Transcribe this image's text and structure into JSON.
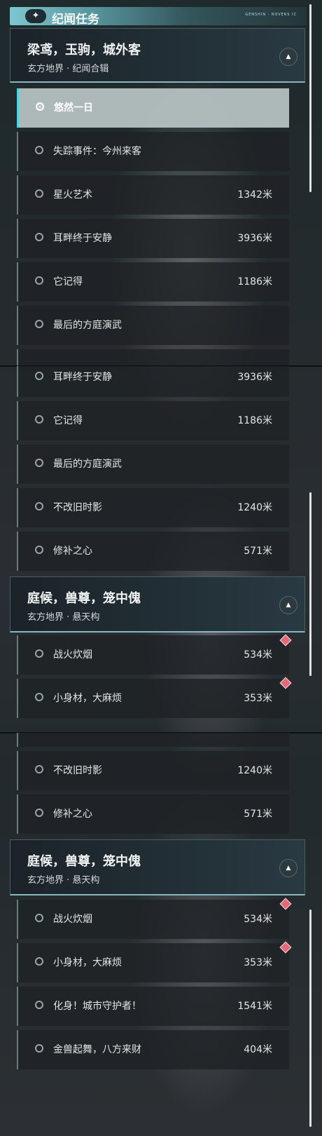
{
  "header": {
    "title": "纪闻任务",
    "star_icon": "✦",
    "tag": "GENSHIN · ROVERS IC"
  },
  "groups": {
    "g1": {
      "title": "梁鸢，玉驹，城外客",
      "subtitle": "玄方地界 · 纪闻合辑"
    },
    "g2": {
      "title": "庭候，兽尊，笼中傀",
      "subtitle": "玄方地界 · 悬天构"
    }
  },
  "quests": {
    "q0": {
      "label": "悠然一日",
      "dist": ""
    },
    "q1": {
      "label": "失踪事件：今州来客",
      "dist": ""
    },
    "q2": {
      "label": "星火艺术",
      "dist": "1342米"
    },
    "q3": {
      "label": "耳畔终于安静",
      "dist": "3936米"
    },
    "q4": {
      "label": "它记得",
      "dist": "1186米"
    },
    "q5": {
      "label": "最后的方庭演武",
      "dist": ""
    },
    "q6": {
      "label": "不改旧时影",
      "dist": "1240米"
    },
    "q7": {
      "label": "修补之心",
      "dist": "571米"
    },
    "q8": {
      "label": "战火炊烟",
      "dist": "534米"
    },
    "q9": {
      "label": "小身材，大麻烦",
      "dist": "353米"
    },
    "q10": {
      "label": "化身！城市守护者！",
      "dist": "1541米"
    },
    "q11": {
      "label": "金兽起舞，八方来财",
      "dist": "404米"
    }
  },
  "selected_quest": "悠然一日",
  "colors": {
    "accent": "#4fd3e0",
    "tracked_marker": "#e06a78",
    "header_bar": "#7ec7d0"
  }
}
